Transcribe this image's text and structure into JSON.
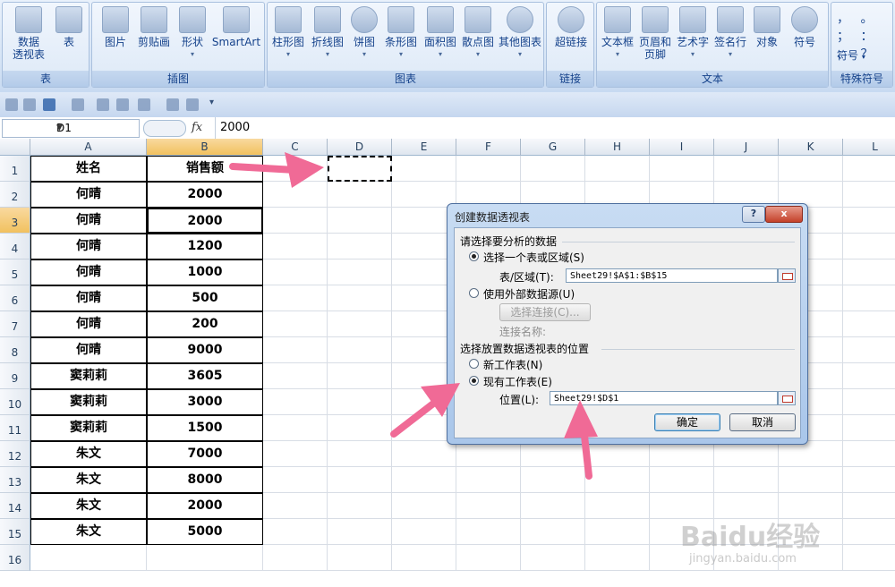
{
  "ribbon": {
    "groups": [
      {
        "title": "表"
      },
      {
        "title": "插图"
      },
      {
        "title": "图表"
      },
      {
        "title": "链接"
      },
      {
        "title": "文本"
      },
      {
        "title": "特殊符号"
      }
    ],
    "buttons": [
      {
        "label": "数据",
        "label2": "透视表",
        "icon": "pivot-table-icon"
      },
      {
        "label": "表",
        "icon": "table-icon"
      },
      {
        "label": "图片",
        "icon": "picture-icon"
      },
      {
        "label": "剪贴画",
        "icon": "clipart-icon"
      },
      {
        "label": "形状",
        "icon": "shapes-icon"
      },
      {
        "label": "SmartArt",
        "icon": "smartart-icon"
      },
      {
        "label": "柱形图",
        "icon": "column-chart-icon"
      },
      {
        "label": "折线图",
        "icon": "line-chart-icon"
      },
      {
        "label": "饼图",
        "icon": "pie-chart-icon"
      },
      {
        "label": "条形图",
        "icon": "bar-chart-icon"
      },
      {
        "label": "面积图",
        "icon": "area-chart-icon"
      },
      {
        "label": "散点图",
        "icon": "scatter-chart-icon"
      },
      {
        "label": "其他图表",
        "icon": "other-charts-icon"
      },
      {
        "label": "超链接",
        "icon": "hyperlink-icon"
      },
      {
        "label": "文本框",
        "icon": "textbox-icon"
      },
      {
        "label": "页眉和",
        "label2": "页脚",
        "icon": "header-footer-icon"
      },
      {
        "label": "艺术字",
        "icon": "wordart-icon"
      },
      {
        "label": "签名行",
        "icon": "signature-line-icon"
      },
      {
        "label": "对象",
        "icon": "object-icon"
      },
      {
        "label": "符号",
        "icon": "omega-icon"
      }
    ],
    "special_symbols": {
      "marks": "， 。 ； ： 、 ？",
      "label": "符号"
    }
  },
  "formula_bar": {
    "cell_ref": "D1",
    "fx": "fx",
    "value": "2000"
  },
  "columns": [
    "A",
    "B",
    "C",
    "D",
    "E",
    "F",
    "G",
    "H",
    "I",
    "J",
    "K",
    "L"
  ],
  "rows": [
    "1",
    "2",
    "3",
    "4",
    "5",
    "6",
    "7",
    "8",
    "9",
    "10",
    "11",
    "12",
    "13",
    "14",
    "15",
    "16"
  ],
  "table": {
    "headers": [
      "姓名",
      "销售额"
    ],
    "rows": [
      [
        "何晴",
        "2000"
      ],
      [
        "何晴",
        "2000"
      ],
      [
        "何晴",
        "1200"
      ],
      [
        "何晴",
        "1000"
      ],
      [
        "何晴",
        "500"
      ],
      [
        "何晴",
        "200"
      ],
      [
        "何晴",
        "9000"
      ],
      [
        "窦莉莉",
        "3605"
      ],
      [
        "窦莉莉",
        "3000"
      ],
      [
        "窦莉莉",
        "1500"
      ],
      [
        "朱文",
        "7000"
      ],
      [
        "朱文",
        "8000"
      ],
      [
        "朱文",
        "2000"
      ],
      [
        "朱文",
        "5000"
      ]
    ]
  },
  "dialog": {
    "title": "创建数据透视表",
    "help": "?",
    "close": "x",
    "section1": "请选择要分析的数据",
    "opt_range": "选择一个表或区域(S)",
    "range_label": "表/区域(T):",
    "range_value": "Sheet29!$A$1:$B$15",
    "opt_external": "使用外部数据源(U)",
    "choose_conn": "选择连接(C)...",
    "conn_name": "连接名称:",
    "section2": "选择放置数据透视表的位置",
    "opt_new": "新工作表(N)",
    "opt_existing": "现有工作表(E)",
    "location_label": "位置(L):",
    "location_value": "Sheet29!$D$1",
    "ok": "确定",
    "cancel": "取消"
  },
  "watermark": {
    "logo": "Baidu经验",
    "url": "jingyan.baidu.com"
  },
  "colors": {
    "accent": "#f1c15f",
    "arrow": "#f06a96"
  }
}
